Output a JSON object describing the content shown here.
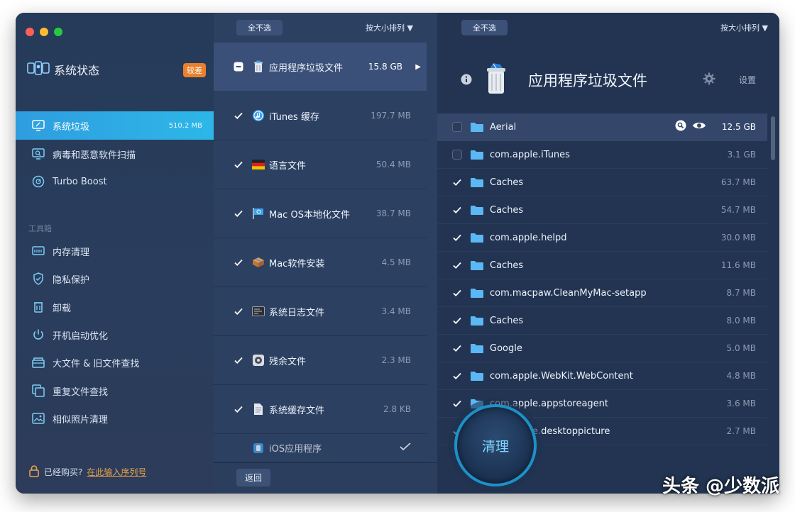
{
  "sidebar": {
    "brand_label": "系统状态",
    "brand_badge": "较差",
    "nav_main": [
      {
        "label": "系统垃圾",
        "size": "510.2 MB"
      },
      {
        "label": "病毒和恶意软件扫描"
      },
      {
        "label": "Turbo Boost"
      }
    ],
    "tools_label": "工具箱",
    "nav_tools": [
      {
        "label": "内存清理"
      },
      {
        "label": "隐私保护"
      },
      {
        "label": "卸载"
      },
      {
        "label": "开机启动优化"
      },
      {
        "label": "大文件 & 旧文件查找"
      },
      {
        "label": "重复文件查找"
      },
      {
        "label": "相似照片清理"
      }
    ],
    "purchase_prompt": "已经购买?",
    "purchase_link": "在此输入序列号"
  },
  "middle": {
    "deselect_all": "全不选",
    "sort_label": "按大小排列 ▼",
    "categories": [
      {
        "label": "应用程序垃圾文件",
        "size": "15.8 GB",
        "state": "partial"
      },
      {
        "label": "iTunes 缓存",
        "size": "197.7 MB",
        "state": "checked"
      },
      {
        "label": "语言文件",
        "size": "50.4 MB",
        "state": "checked"
      },
      {
        "label": "Mac OS本地化文件",
        "size": "38.7 MB",
        "state": "checked"
      },
      {
        "label": "Mac软件安装",
        "size": "4.5 MB",
        "state": "checked"
      },
      {
        "label": "系统日志文件",
        "size": "3.4 MB",
        "state": "checked"
      },
      {
        "label": "残余文件",
        "size": "2.3 MB",
        "state": "checked"
      },
      {
        "label": "系统缓存文件",
        "size": "2.8 KB",
        "state": "checked"
      },
      {
        "label": "iOS应用程序",
        "size": "",
        "state": "checked"
      }
    ],
    "back_label": "返回"
  },
  "right": {
    "deselect_all": "全不选",
    "sort_label": "按大小排列 ▼",
    "title": "应用程序垃圾文件",
    "settings_label": "设置",
    "files": [
      {
        "name": "Aerial",
        "size": "12.5 GB",
        "checked": false
      },
      {
        "name": "com.apple.iTunes",
        "size": "3.1 GB",
        "checked": false
      },
      {
        "name": "Caches",
        "size": "63.7 MB",
        "checked": true
      },
      {
        "name": "Caches",
        "size": "54.7 MB",
        "checked": true
      },
      {
        "name": "com.apple.helpd",
        "size": "30.0 MB",
        "checked": true
      },
      {
        "name": "Caches",
        "size": "11.6 MB",
        "checked": true
      },
      {
        "name": "com.macpaw.CleanMyMac-setapp",
        "size": "8.7 MB",
        "checked": true
      },
      {
        "name": "Caches",
        "size": "8.0 MB",
        "checked": true
      },
      {
        "name": "Google",
        "size": "5.0 MB",
        "checked": true
      },
      {
        "name": "com.apple.WebKit.WebContent",
        "size": "4.8 MB",
        "checked": true
      },
      {
        "name": "com.apple.appstoreagent",
        "size": "3.6 MB",
        "checked": true
      },
      {
        "name": "com.apple.desktoppicture",
        "size": "2.7 MB",
        "checked": true
      }
    ],
    "clean_label": "清理"
  },
  "watermark": "头条 @少数派",
  "colors": {
    "accent": "#2db0e6",
    "badge": "#e9812c",
    "folder": "#5bb8f4"
  }
}
